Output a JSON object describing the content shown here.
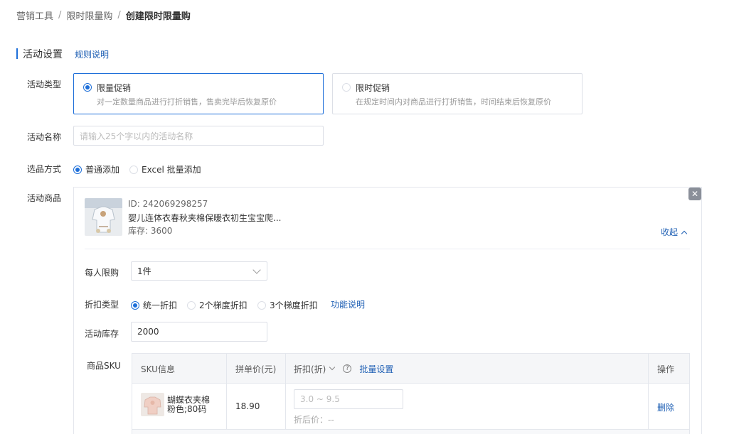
{
  "breadcrumb": {
    "items": [
      "营销工具",
      "限时限量购",
      "创建限时限量购"
    ],
    "separator": "/"
  },
  "section": {
    "title": "活动设置",
    "rule_link": "规则说明"
  },
  "activity_type": {
    "label": "活动类型",
    "options": [
      {
        "title": "限量促销",
        "desc": "对一定数量商品进行打折销售，售卖完毕后恢复原价",
        "selected": true
      },
      {
        "title": "限时促销",
        "desc": "在规定时间内对商品进行打折销售，时间结束后恢复原价",
        "selected": false
      }
    ]
  },
  "activity_name": {
    "label": "活动名称",
    "placeholder": "请输入25个字以内的活动名称",
    "value": ""
  },
  "selection_method": {
    "label": "选品方式",
    "options": [
      {
        "label": "普通添加",
        "selected": true
      },
      {
        "label": "Excel 批量添加",
        "selected": false
      }
    ]
  },
  "activity_goods": {
    "label": "活动商品",
    "product": {
      "id_text": "ID: 242069298257",
      "name": "婴儿连体衣春秋夹棉保暖衣初生宝宝爬...",
      "stock_text": "库存: 3600",
      "collapse_label": "收起"
    },
    "per_person_limit": {
      "label": "每人限购",
      "value": "1件"
    },
    "discount_type": {
      "label": "折扣类型",
      "options": [
        {
          "label": "统一折扣",
          "selected": true
        },
        {
          "label": "2个梯度折扣",
          "selected": false
        },
        {
          "label": "3个梯度折扣",
          "selected": false
        }
      ],
      "help_link": "功能说明"
    },
    "activity_stock": {
      "label": "活动库存",
      "value": "2000"
    },
    "sku": {
      "label": "商品SKU",
      "columns": {
        "sku_info": "SKU信息",
        "group_price": "拼单价(元)",
        "discount": "折扣(折)",
        "help_icon": "?",
        "batch_set": "批量设置",
        "action": "操作"
      },
      "rows": [
        {
          "name_line1": "蝴蝶衣夹棉",
          "name_line2": "粉色;80码",
          "price": "18.90",
          "discount_placeholder": "3.0 ~ 9.5",
          "after_discount": "折后价：--",
          "action": "删除"
        }
      ]
    }
  },
  "colors": {
    "accent": "#1e6fd9",
    "link": "#1e5fb4",
    "border": "#dcdfe6",
    "muted": "#999999"
  },
  "icons": {
    "close": "close-icon",
    "chevron_down": "chevron-down-icon",
    "chevron_up": "chevron-up-icon",
    "help": "question-circle-icon"
  }
}
